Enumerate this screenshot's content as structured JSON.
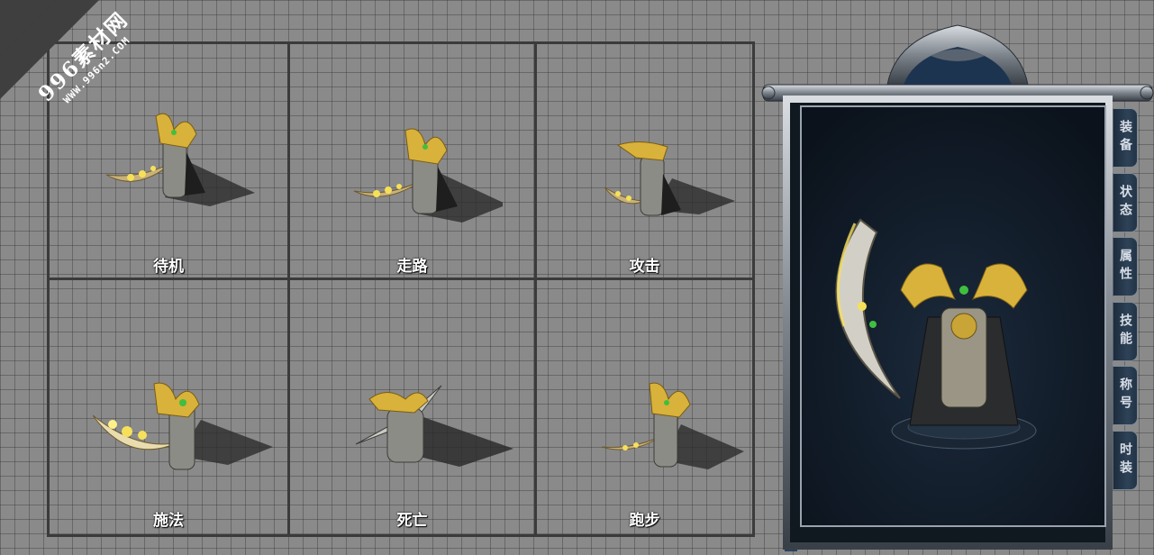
{
  "watermark": {
    "title": "996素材网",
    "url": "WWW.996n2.COM"
  },
  "animations": [
    {
      "label": "待机"
    },
    {
      "label": "走路"
    },
    {
      "label": "攻击"
    },
    {
      "label": "施法"
    },
    {
      "label": "死亡"
    },
    {
      "label": "跑步"
    }
  ],
  "panel": {
    "tabs": [
      {
        "label": "装备"
      },
      {
        "label": "状态"
      },
      {
        "label": "属性"
      },
      {
        "label": "技能"
      },
      {
        "label": "称号"
      },
      {
        "label": "时装"
      }
    ]
  },
  "colors": {
    "grid_background": "#8a8a8a",
    "panel_background": "#0f1a27",
    "gold": "#d8b23a",
    "tab_text": "#d7dde6"
  }
}
